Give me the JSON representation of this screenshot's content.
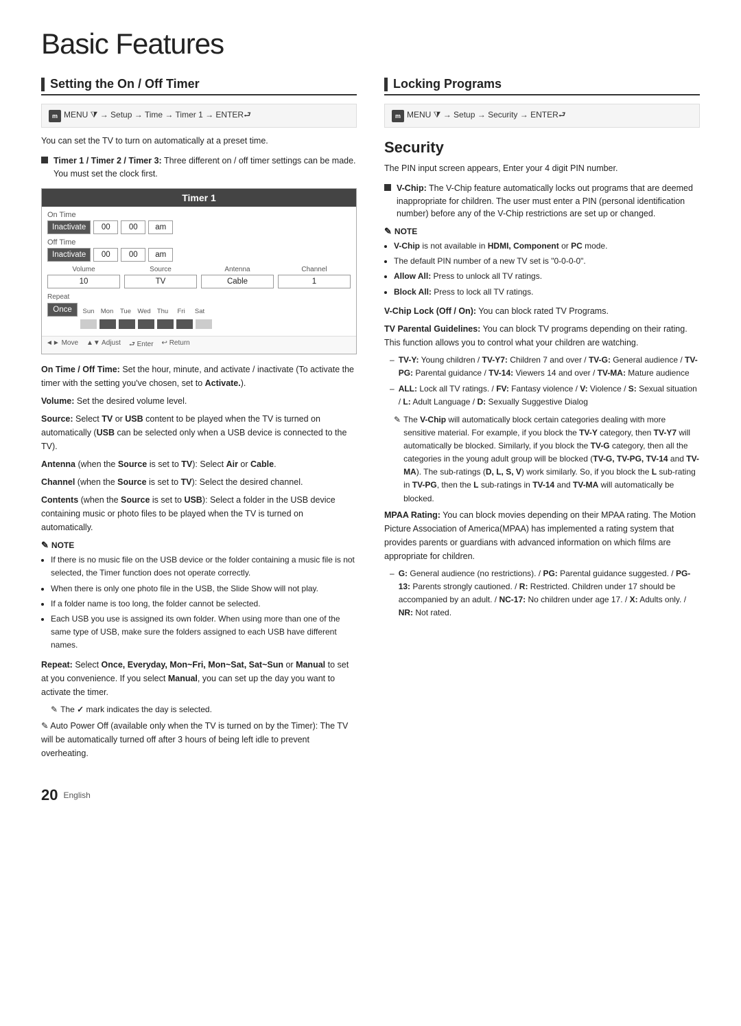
{
  "page": {
    "title": "Basic Features",
    "page_number": "20",
    "language": "English"
  },
  "left_section": {
    "header": "Setting the On / Off Timer",
    "menu_path": "MENU ⧩ → Setup → Time → Timer 1 → ENTER⮐",
    "intro": "You can set the TV to turn on automatically at a preset time.",
    "timer_bullet": "Timer 1 / Timer 2 / Timer 3: Three different on / off timer settings can be made. You must set the clock first.",
    "timer": {
      "title": "Timer 1",
      "on_time_label": "On Time",
      "on_time_inactive": "Inactivate",
      "on_time_h": "00",
      "on_time_m": "00",
      "on_time_ampm": "am",
      "off_time_label": "Off Time",
      "off_time_inactive": "Inactivate",
      "off_time_h": "00",
      "off_time_m": "00",
      "off_time_ampm": "am",
      "col_volume": "Volume",
      "col_source": "Source",
      "col_antenna": "Antenna",
      "col_channel": "Channel",
      "val_volume": "10",
      "val_source": "TV",
      "val_antenna": "Cable",
      "val_channel": "1",
      "repeat_label": "Repeat",
      "repeat_val": "Once",
      "days": [
        "Sun",
        "Mon",
        "Tue",
        "Wed",
        "Thu",
        "Fri",
        "Sat"
      ],
      "days_filled": [
        false,
        true,
        true,
        true,
        true,
        true,
        false
      ],
      "nav": [
        "◄► Move",
        "↑↓ Adjust",
        "⮐ Enter",
        "↩ Return"
      ]
    },
    "on_off_time_text": "On Time / Off Time: Set the hour, minute, and activate / inactivate (To activate the timer with the setting you’ve chosen, set to Activate.).",
    "volume_text": "Volume: Set the desired volume level.",
    "source_text": "Source: Select TV or USB content to be played when the TV is turned on automatically (USB can be selected only when a USB device is connected to the TV).",
    "antenna_text": "Antenna (when the Source is set to TV): Select Air or Cable.",
    "channel_text": "Channel (when the Source is set to TV): Select the desired channel.",
    "contents_text": "Contents (when the Source is set to USB): Select a folder in the USB device containing music or photo files to be played when the TV is turned on automatically.",
    "note_label": "NOTE",
    "notes": [
      "If there is no music file on the USB device or the folder containing a music file is not selected, the Timer function does not operate correctly.",
      "When there is only one photo file in the USB, the Slide Show will not play.",
      "If a folder name is too long, the folder cannot be selected.",
      "Each USB you use is assigned its own folder. When using more than one of the same type of USB, make sure the folders assigned to each USB have different names."
    ],
    "repeat_text": "Repeat: Select Once, Everyday, Mon~Fri, Mon~Sat, Sat~Sun or Manual to set at you convenience. If you select Manual, you can set up the day you want to activate the timer.",
    "check_note": "The ✓ mark indicates the day is selected.",
    "auto_power_text": "Auto Power Off (available only when the TV is turned on by the Timer): The TV will be automatically turned off after 3 hours of being left idle to prevent overheating."
  },
  "right_section": {
    "header": "Locking Programs",
    "menu_path": "MENU ⧩ → Setup → Security → ENTER⮐",
    "sub_title": "Security",
    "intro": "The PIN input screen appears, Enter your 4 digit PIN number.",
    "vchip_bullet": "V-Chip: The V-Chip feature automatically locks out programs that are deemed inappropriate for children. The user must enter a PIN (personal identification number) before any of the V-Chip restrictions are set up or changed.",
    "note_label": "NOTE",
    "notes": [
      "V-Chip is not available in HDMI, Component or PC mode.",
      "The default PIN number of a new TV set is “0-0-0-0”.",
      "Allow All: Press to unlock all TV ratings.",
      "Block All: Press to lock all TV ratings."
    ],
    "vchip_lock_text": "V-Chip Lock (Off / On): You can block rated TV Programs.",
    "tv_parental_text": "TV Parental Guidelines: You can block TV programs depending on their rating. This function allows you to control what your children are watching.",
    "tv_ratings": [
      "TV-Y: Young children / TV-Y7: Children 7 and over / TV-G: General audience / TV-PG: Parental guidance / TV-14: Viewers 14 and over / TV-MA: Mature audience",
      "ALL: Lock all TV ratings. / FV: Fantasy violence / V: Violence / S: Sexual situation / L: Adult Language / D: Sexually Suggestive Dialog"
    ],
    "vchip_auto_note": "The V-Chip will automatically block certain categories dealing with more sensitive material. For example, if you block the TV-Y category, then TV-Y7 will automatically be blocked. Similarly, if you block the TV-G category, then all the categories in the young adult group will be blocked (TV-G, TV-PG, TV-14 and TV-MA). The sub-ratings (D, L, S, V) work similarly. So, if you block the L sub-rating in TV-PG, then the L sub-ratings in TV-14 and TV-MA will automatically be blocked.",
    "mpaa_text": "MPAA Rating: You can block movies depending on their MPAA rating. The Motion Picture Association of America(MPAA) has implemented a rating system that provides parents or guardians with advanced information on which films are appropriate for children.",
    "mpaa_ratings": "G: General audience (no restrictions). / PG: Parental guidance suggested. / PG-13: Parents strongly cautioned. / R: Restricted. Children under 17 should be accompanied by an adult. / NC-17: No children under age 17. / X: Adults only. / NR: Not rated."
  }
}
